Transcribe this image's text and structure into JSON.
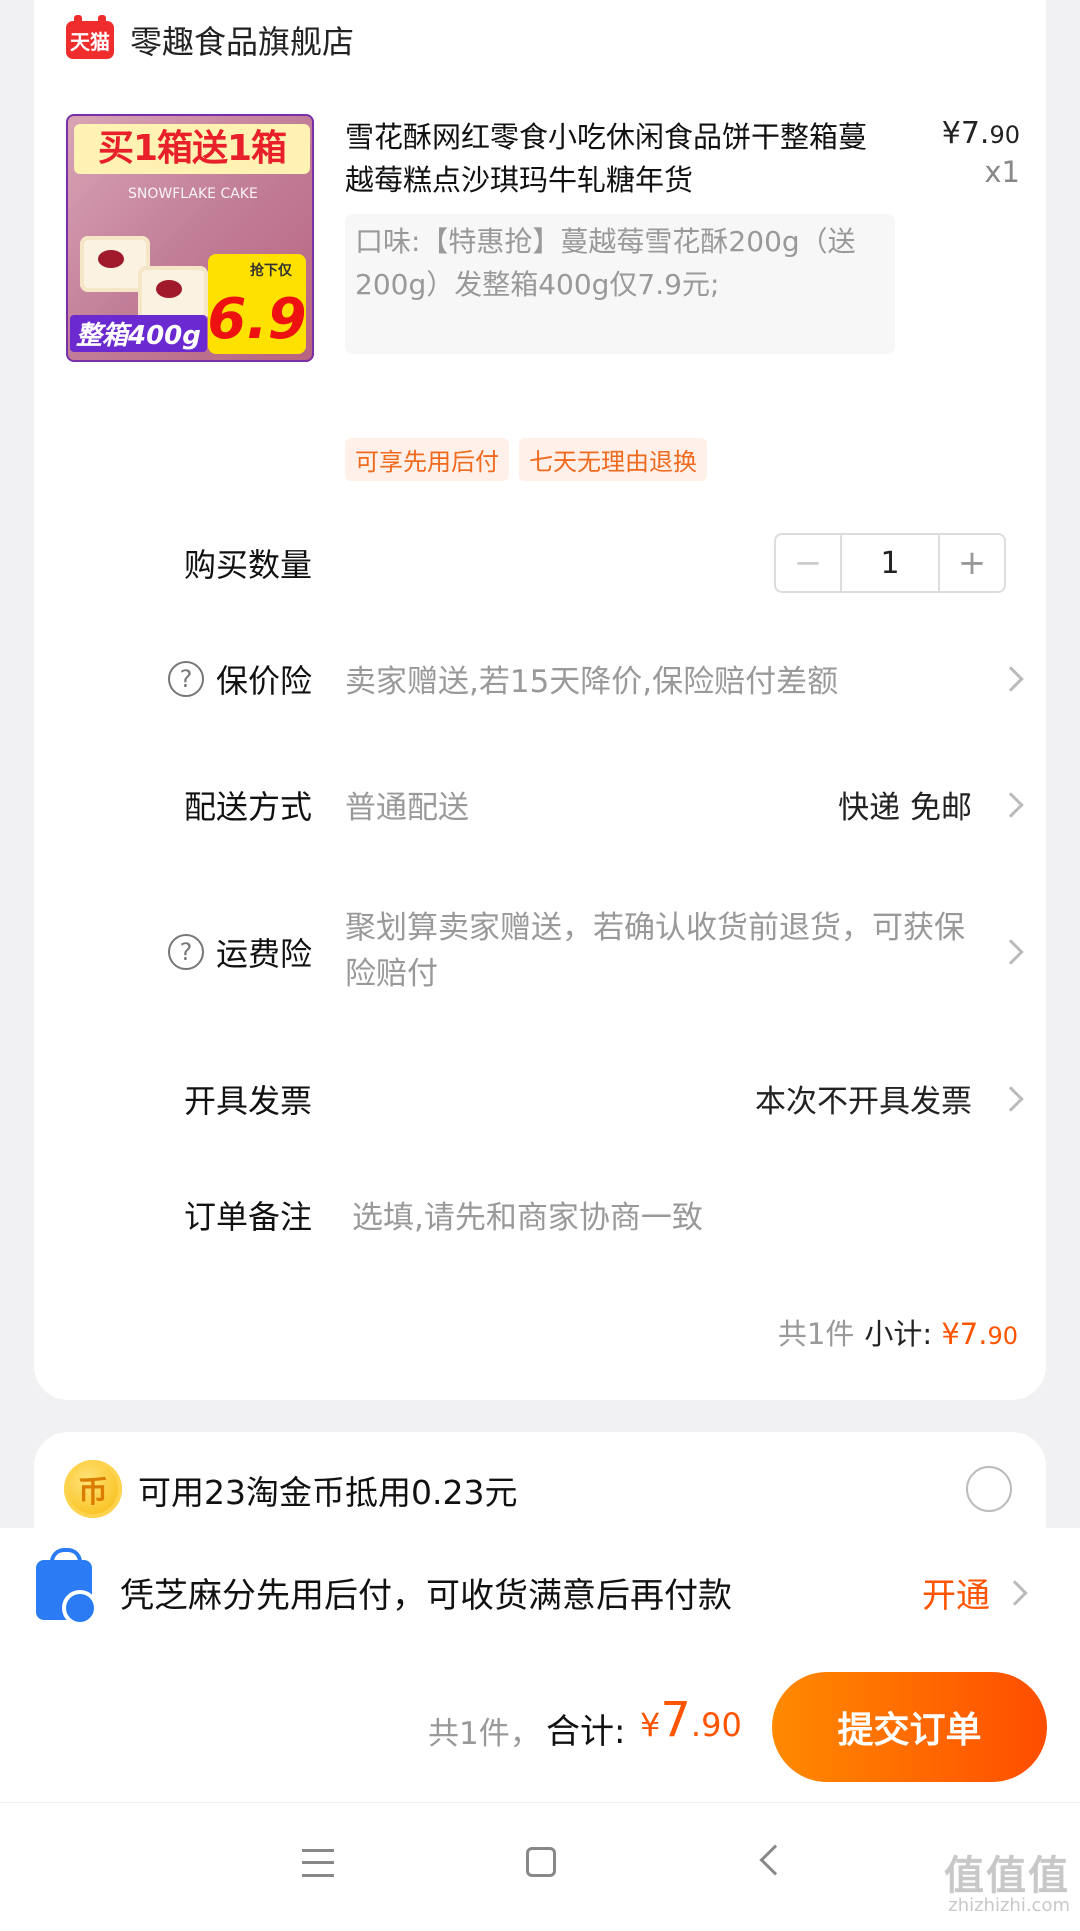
{
  "store": {
    "badge": "天猫",
    "name": "零趣食品旗舰店"
  },
  "product": {
    "image": {
      "banner": "买1箱送1箱",
      "sub": "SNOWFLAKE CAKE",
      "price_tag": "抢下仅",
      "price": "6.9",
      "box_label": "整箱400g"
    },
    "title": "雪花酥网红零食小吃休闲食品饼干整箱蔓越莓糕点沙琪玛牛轧糖年货",
    "price_symbol": "¥",
    "price_int": "7.",
    "price_dec": "90",
    "quantity_label": "x1",
    "spec": "口味:【特惠抢】蔓越莓雪花酥200g（送200g）发整箱400g仅7.9元;",
    "tags": [
      "可享先用后付",
      "七天无理由退换"
    ]
  },
  "rows": {
    "quantity": {
      "label": "购买数量",
      "minus": "−",
      "value": "1",
      "plus": "+"
    },
    "price_protection": {
      "label": "保价险",
      "value": "卖家赠送,若15天降价,保险赔付差额"
    },
    "delivery": {
      "label": "配送方式",
      "value": "普通配送",
      "right": "快递 免邮"
    },
    "shipping_insurance": {
      "label": "运费险",
      "value": "聚划算卖家赠送，若确认收货前退货，可获保险赔付"
    },
    "invoice": {
      "label": "开具发票",
      "right": "本次不开具发票"
    },
    "note": {
      "label": "订单备注",
      "placeholder": "选填,请先和商家协商一致"
    }
  },
  "subtotal": {
    "count": "共1件",
    "label": "小计:",
    "symbol": "¥",
    "int": "7.",
    "dec": "90"
  },
  "coins": {
    "icon": "币",
    "text": "可用23淘金币抵用0.23元"
  },
  "credit": {
    "text": "凭芝麻分先用后付，可收货满意后再付款",
    "action": "开通"
  },
  "checkout": {
    "count": "共1件，",
    "label": "合计:",
    "symbol": "¥",
    "int": "7",
    "dec": ".90",
    "button": "提交订单"
  },
  "watermark": {
    "main": "值值值",
    "sub": "zhizhizhi.com"
  },
  "help_icon": "?"
}
